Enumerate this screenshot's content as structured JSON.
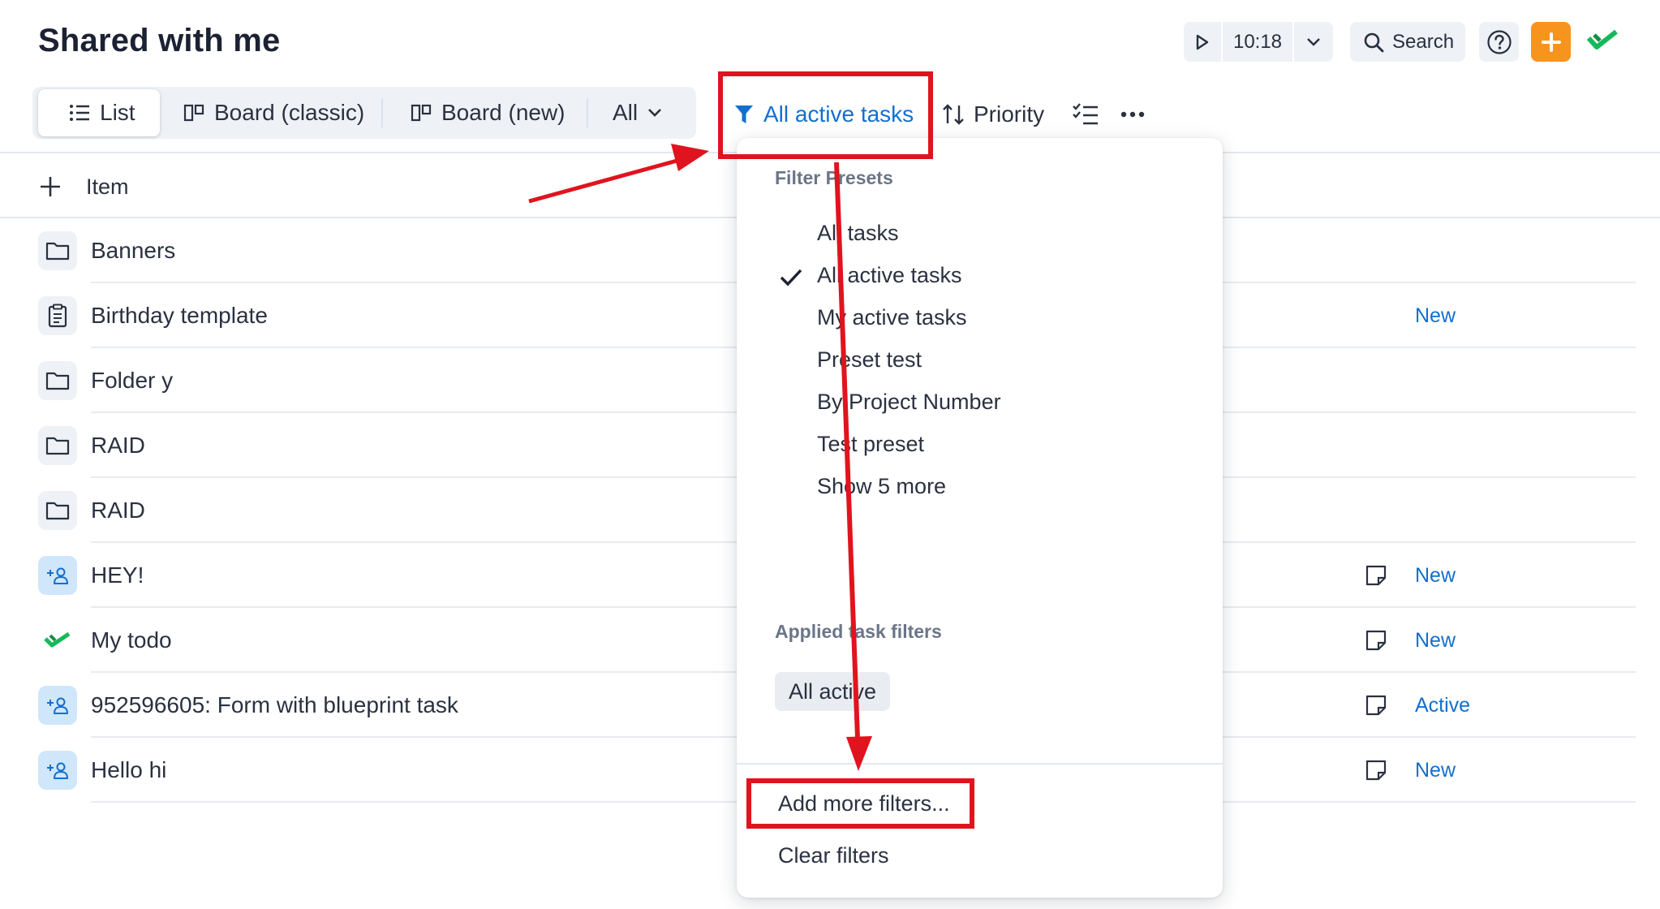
{
  "page": {
    "title": "Shared with me"
  },
  "toolbar": {
    "timer_value": "10:18",
    "search_label": "Search"
  },
  "views": {
    "list": "List",
    "board_classic": "Board (classic)",
    "board_new": "Board (new)",
    "scope": "All"
  },
  "filter_button": {
    "label": "All active tasks"
  },
  "sort_button": {
    "label": "Priority"
  },
  "add_item": {
    "label": "Item"
  },
  "items": [
    {
      "name": "Banners",
      "icon": "folder-icon",
      "status": ""
    },
    {
      "name": "Birthday template",
      "icon": "clipboard-icon",
      "status": "New"
    },
    {
      "name": "Folder y",
      "icon": "folder-icon",
      "status": ""
    },
    {
      "name": "RAID",
      "icon": "folder-icon",
      "status": ""
    },
    {
      "name": "RAID",
      "icon": "folder-icon",
      "status": ""
    },
    {
      "name": "HEY!",
      "icon": "add-user-icon",
      "status": "New"
    },
    {
      "name": "My todo",
      "icon": "double-check-icon",
      "status": "New"
    },
    {
      "name": "952596605: Form with blueprint task",
      "icon": "add-user-icon",
      "status": "Active"
    },
    {
      "name": "Hello hi",
      "icon": "add-user-icon",
      "status": "New"
    }
  ],
  "dropdown": {
    "presets_heading": "Filter Presets",
    "presets": [
      {
        "label": "All tasks",
        "selected": false
      },
      {
        "label": "All active tasks",
        "selected": true
      },
      {
        "label": "My active tasks",
        "selected": false
      },
      {
        "label": "Preset test",
        "selected": false
      },
      {
        "label": "By Project Number",
        "selected": false
      },
      {
        "label": "Test preset",
        "selected": false
      },
      {
        "label": "Show 5 more",
        "selected": false
      }
    ],
    "applied_heading": "Applied task filters",
    "applied_chip": "All active",
    "add_filters": "Add more filters...",
    "clear_filters": "Clear filters"
  },
  "colors": {
    "accent_blue": "#1170cf",
    "brand_green": "#17b85b",
    "add_orange": "#f7941d",
    "annotation_red": "#e0141e"
  }
}
